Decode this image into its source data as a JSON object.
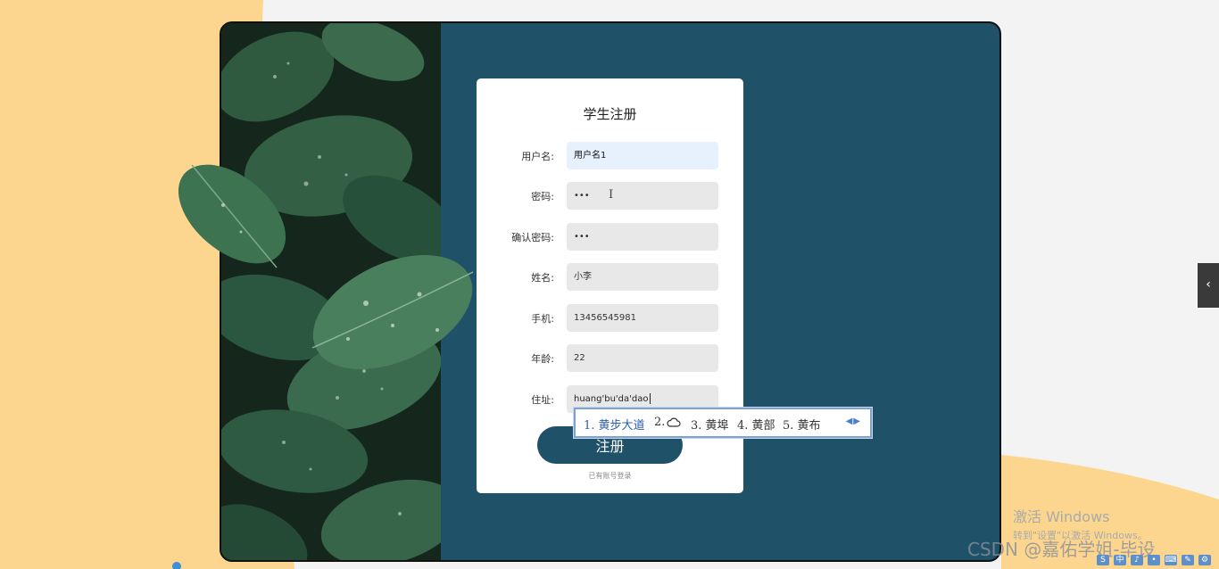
{
  "form": {
    "title": "学生注册",
    "fields": [
      {
        "label": "用户名:",
        "value": "用户名1",
        "type": "text"
      },
      {
        "label": "密码:",
        "value": "•••",
        "type": "password"
      },
      {
        "label": "确认密码:",
        "value": "•••",
        "type": "password"
      },
      {
        "label": "姓名:",
        "value": "小李",
        "type": "text"
      },
      {
        "label": "手机:",
        "value": "13456545981",
        "type": "text"
      },
      {
        "label": "年龄:",
        "value": "22",
        "type": "text"
      },
      {
        "label": "住址:",
        "value": "huang'bu'da'dao",
        "type": "text"
      }
    ],
    "submit_label": "注册",
    "login_link": "已有账号登录"
  },
  "ime": {
    "candidates": [
      "1. 黄步大道",
      "2.",
      "3. 黄埠",
      "4. 黄部",
      "5. 黄布"
    ],
    "cloud_icon": "cloud-icon",
    "arrows": "◀▶"
  },
  "side_toggle": {
    "glyph": "‹"
  },
  "watermark": {
    "line1": "激活 Windows",
    "line2": "转到\"设置\"以激活 Windows。"
  },
  "csdn_watermark": "CSDN @嘉佑学姐-毕设",
  "tray": [
    "S",
    "中",
    "♪",
    "•",
    "⌨",
    "✎",
    "⚙"
  ],
  "colors": {
    "page_bg": "#f3f3f4",
    "peach": "#fcd68f",
    "card_bg": "#1f5169",
    "button_bg": "#1f5169",
    "ime_border": "#7ea2d4"
  }
}
